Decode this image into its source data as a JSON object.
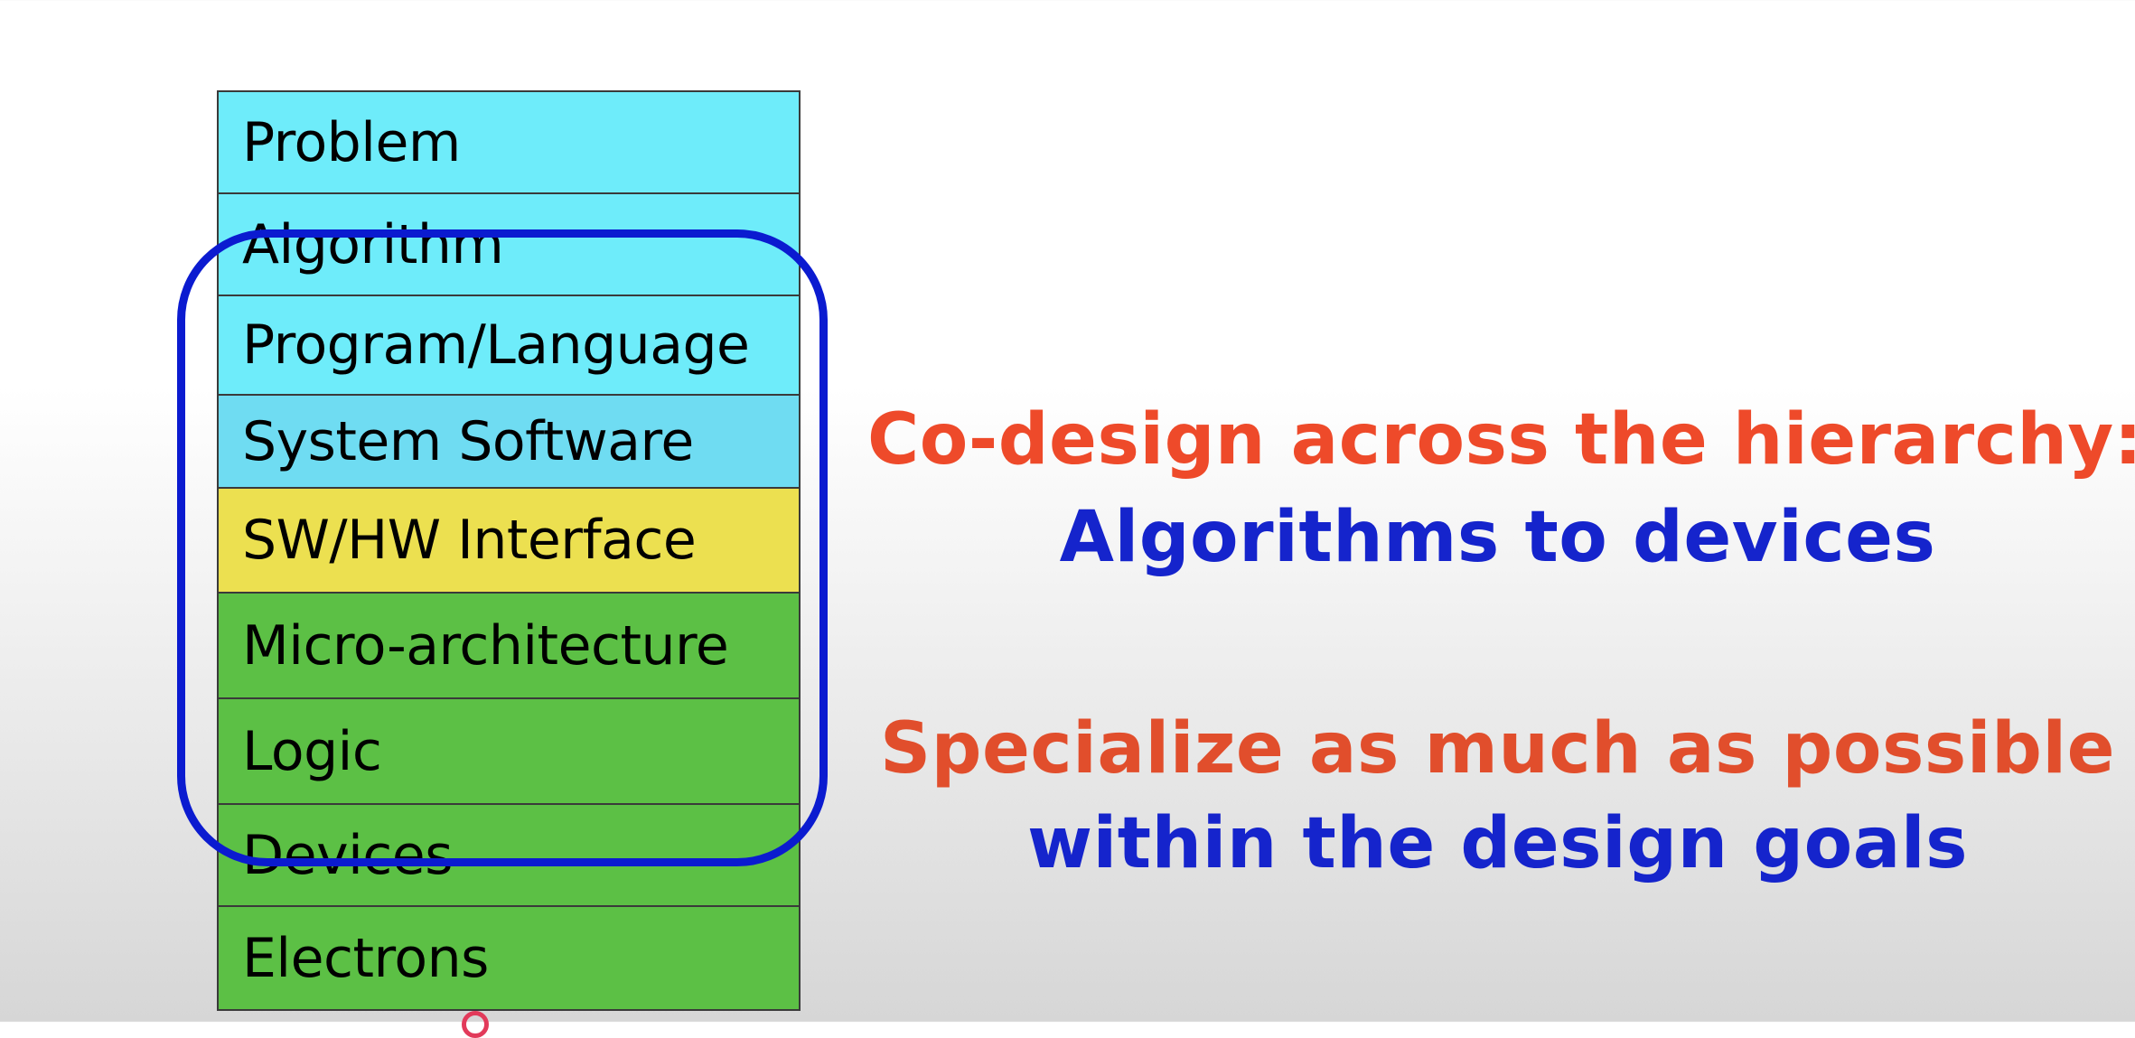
{
  "layers": [
    {
      "label": "Problem",
      "color": "#6eecfa"
    },
    {
      "label": "Algorithm",
      "color": "#6eecfa"
    },
    {
      "label": "Program/Language",
      "color": "#6eecfa"
    },
    {
      "label": "System Software",
      "color": "#6fdcf2"
    },
    {
      "label": "SW/HW Interface",
      "color": "#ece050"
    },
    {
      "label": "Micro-architecture",
      "color": "#5cc045"
    },
    {
      "label": "Logic",
      "color": "#5cc045"
    },
    {
      "label": "Devices",
      "color": "#5cc045"
    },
    {
      "label": "Electrons",
      "color": "#5cc045"
    }
  ],
  "highlight": {
    "color": "#0b1bd0",
    "from_layer": "Algorithm",
    "to_layer": "Devices"
  },
  "messages": [
    {
      "text": "Co-design across the hierarchy:",
      "color": "#ee4a2a"
    },
    {
      "text": "Algorithms to devices",
      "color": "#1524cc"
    },
    {
      "text": "Specialize as much as possible",
      "color": "#e14e2c"
    },
    {
      "text": "within the design goals",
      "color": "#1524cc"
    }
  ]
}
